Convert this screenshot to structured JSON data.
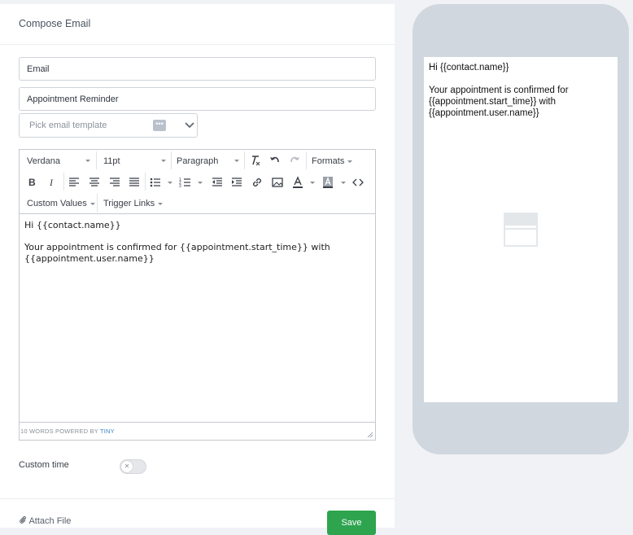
{
  "panel": {
    "title": "Compose Email"
  },
  "fields": {
    "email_value": "Email",
    "subject_value": "Appointment Reminder",
    "template_placeholder": "Pick email template"
  },
  "toolbar": {
    "font_family": "Verdana",
    "font_size": "11pt",
    "block_format": "Paragraph",
    "formats": "Formats",
    "custom_values": "Custom Values",
    "trigger_links": "Trigger Links",
    "bold": "B",
    "italic": "I"
  },
  "editor": {
    "line1": "Hi {{contact.name}}",
    "line2": "Your appointment is confirmed for {{appointment.start_time}} with {{appointment.user.name}}",
    "status_prefix": "10 WORDS POWERED BY ",
    "status_brand": "TINY"
  },
  "custom_time": {
    "label": "Custom time",
    "enabled": false
  },
  "footer": {
    "attach_label": "Attach File",
    "save_label": "Save"
  },
  "preview": {
    "line1": "Hi {{contact.name}}",
    "line2": "Your appointment is confirmed for {{appointment.start_time}} with {{appointment.user.name}}"
  },
  "colors": {
    "save": "#2ea44f",
    "phone": "#d0d7df",
    "brand_link": "#3a86c8"
  },
  "icons": [
    "clear-format-icon",
    "undo-icon",
    "redo-icon",
    "align-left-icon",
    "align-center-icon",
    "align-right-icon",
    "justify-icon",
    "bullet-list-icon",
    "numbered-list-icon",
    "outdent-icon",
    "indent-icon",
    "link-icon",
    "image-icon",
    "text-color-icon",
    "background-color-icon",
    "source-code-icon",
    "paperclip-icon",
    "image-placeholder-icon"
  ]
}
